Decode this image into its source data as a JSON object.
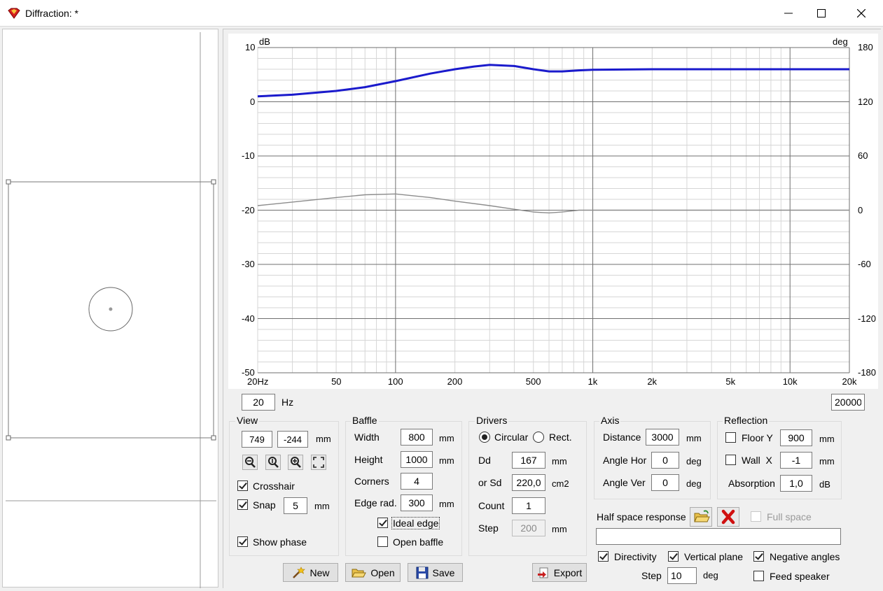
{
  "window": {
    "title": "Diffraction: *",
    "icon": "red-diamond-icon",
    "controls": [
      "minimize-icon",
      "maximize-icon",
      "close-icon"
    ]
  },
  "chart_data": {
    "type": "line",
    "x_scale": "log",
    "x_range": [
      20,
      20000
    ],
    "x_tick_labels": [
      "20Hz",
      "50",
      "100",
      "200",
      "500",
      "1k",
      "2k",
      "5k",
      "10k",
      "20k"
    ],
    "x_tick_values": [
      20,
      50,
      100,
      200,
      500,
      1000,
      2000,
      5000,
      10000,
      20000
    ],
    "y_left_label": "dB",
    "y_left_range": [
      -50,
      10
    ],
    "y_left_ticks": [
      "10",
      "0",
      "-10",
      "-20",
      "-30",
      "-40",
      "-50"
    ],
    "y_right_label": "deg",
    "y_right_range": [
      -180,
      180
    ],
    "y_right_ticks": [
      "180",
      "120",
      "60",
      "0",
      "-60",
      "-120",
      "-180"
    ],
    "grid": true,
    "series": [
      {
        "color": "#1a1acc",
        "axis": "left",
        "points": [
          [
            20,
            1.0
          ],
          [
            30,
            1.3
          ],
          [
            50,
            2.0
          ],
          [
            70,
            2.7
          ],
          [
            100,
            3.8
          ],
          [
            150,
            5.2
          ],
          [
            200,
            6.0
          ],
          [
            250,
            6.5
          ],
          [
            300,
            6.8
          ],
          [
            400,
            6.6
          ],
          [
            500,
            6.0
          ],
          [
            600,
            5.6
          ],
          [
            700,
            5.6
          ],
          [
            850,
            5.8
          ],
          [
            1000,
            5.9
          ],
          [
            2000,
            6.0
          ],
          [
            5000,
            6.0
          ],
          [
            10000,
            6.0
          ],
          [
            20000,
            6.0
          ]
        ]
      },
      {
        "color": "#8c8c8c",
        "axis": "right",
        "points": [
          [
            20,
            5
          ],
          [
            30,
            9
          ],
          [
            50,
            14
          ],
          [
            70,
            17
          ],
          [
            100,
            18
          ],
          [
            150,
            14
          ],
          [
            200,
            10
          ],
          [
            300,
            5
          ],
          [
            400,
            1
          ],
          [
            500,
            -2
          ],
          [
            600,
            -3
          ],
          [
            700,
            -2
          ],
          [
            850,
            0
          ],
          [
            1000,
            0
          ],
          [
            2000,
            0
          ],
          [
            5000,
            0
          ],
          [
            10000,
            0
          ],
          [
            20000,
            0
          ]
        ]
      }
    ]
  },
  "freq_range": {
    "min": "20",
    "unit": "Hz",
    "max": "20000"
  },
  "view": {
    "title": "View",
    "x": "749",
    "y": "-244",
    "unit": "mm",
    "tool_icons": [
      "zoom-out-icon",
      "zoom-reset-icon",
      "zoom-in-icon",
      "zoom-fit-icon"
    ],
    "crosshair_label": "Crosshair",
    "crosshair": true,
    "snap_label": "Snap",
    "snap": true,
    "snap_value": "5",
    "snap_unit": "mm",
    "show_phase_label": "Show phase",
    "show_phase": true
  },
  "baffle": {
    "title": "Baffle",
    "width_label": "Width",
    "width": "800",
    "width_unit": "mm",
    "height_label": "Height",
    "height": "1000",
    "height_unit": "mm",
    "corners_label": "Corners",
    "corners": "4",
    "edge_rad_label": "Edge rad.",
    "edge_rad": "300",
    "edge_rad_unit": "mm",
    "ideal_edge_label": "Ideal edge",
    "ideal_edge": true,
    "open_baffle_label": "Open baffle",
    "open_baffle": false
  },
  "drivers": {
    "title": "Drivers",
    "circular_label": "Circular",
    "rect_label": "Rect.",
    "shape": "circular",
    "dd_label": "Dd",
    "dd": "167",
    "dd_unit": "mm",
    "sd_label": "or Sd",
    "sd": "220,0",
    "sd_unit": "cm2",
    "count_label": "Count",
    "count": "1",
    "step_label": "Step",
    "step": "200",
    "step_unit": "mm"
  },
  "axis": {
    "title": "Axis",
    "distance_label": "Distance",
    "distance": "3000",
    "distance_unit": "mm",
    "angle_hor_label": "Angle Hor",
    "angle_hor": "0",
    "angle_hor_unit": "deg",
    "angle_ver_label": "Angle Ver",
    "angle_ver": "0",
    "angle_ver_unit": "deg"
  },
  "reflection": {
    "title": "Reflection",
    "floor_label": "Floor Y",
    "floor": false,
    "floor_value": "900",
    "floor_unit": "mm",
    "wall_label": "Wall  X",
    "wall": false,
    "wall_value": "-1",
    "wall_unit": "mm",
    "absorption_label": "Absorption",
    "absorption": "1,0",
    "absorption_unit": "dB"
  },
  "half_space": {
    "label": "Half space response",
    "open_icon": "folder-open-icon",
    "clear_icon": "red-x-icon",
    "full_space_label": "Full space",
    "full_space": false,
    "path": ""
  },
  "options": {
    "directivity_label": "Directivity",
    "directivity": true,
    "vertical_plane_label": "Vertical plane",
    "vertical_plane": true,
    "negative_angles_label": "Negative angles",
    "negative_angles": true,
    "step_label": "Step",
    "step": "10",
    "step_unit": "deg",
    "feed_speaker_label": "Feed speaker",
    "feed_speaker": false
  },
  "buttons": {
    "new_label": "New",
    "open_label": "Open",
    "save_label": "Save",
    "export_label": "Export"
  }
}
